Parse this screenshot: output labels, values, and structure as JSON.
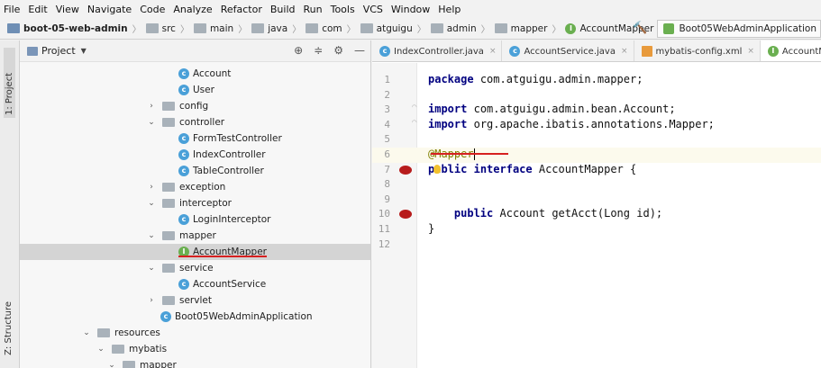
{
  "menu": [
    "File",
    "Edit",
    "View",
    "Navigate",
    "Code",
    "Analyze",
    "Refactor",
    "Build",
    "Run",
    "Tools",
    "VCS",
    "Window",
    "Help"
  ],
  "breadcrumb": [
    "boot-05-web-admin",
    "src",
    "main",
    "java",
    "com",
    "atguigu",
    "admin",
    "mapper",
    "AccountMapper"
  ],
  "run_config": "Boot05WebAdminApplication",
  "side_tabs": {
    "project": "1: Project",
    "structure": "Z: Structure"
  },
  "project_panel": {
    "title": "Project"
  },
  "tree": [
    {
      "label": "Account",
      "icon": "class-icon"
    },
    {
      "label": "User",
      "icon": "class-icon"
    },
    {
      "label": "config",
      "icon": "package-icon",
      "arrow": "›"
    },
    {
      "label": "controller",
      "icon": "package-icon",
      "arrow": "⌄"
    },
    {
      "label": "FormTestController",
      "icon": "class-icon"
    },
    {
      "label": "IndexController",
      "icon": "class-icon"
    },
    {
      "label": "TableController",
      "icon": "class-icon"
    },
    {
      "label": "exception",
      "icon": "package-icon",
      "arrow": "›"
    },
    {
      "label": "interceptor",
      "icon": "package-icon",
      "arrow": "⌄"
    },
    {
      "label": "LoginInterceptor",
      "icon": "class-icon"
    },
    {
      "label": "mapper",
      "icon": "package-icon",
      "arrow": "⌄"
    },
    {
      "label": "AccountMapper",
      "icon": "interface-icon",
      "selected": true
    },
    {
      "label": "service",
      "icon": "package-icon",
      "arrow": "⌄"
    },
    {
      "label": "AccountService",
      "icon": "class-icon"
    },
    {
      "label": "servlet",
      "icon": "package-icon",
      "arrow": "›"
    },
    {
      "label": "Boot05WebAdminApplication",
      "icon": "spring-class-icon"
    },
    {
      "label": "resources",
      "icon": "resources-folder-icon",
      "arrow": "⌄"
    },
    {
      "label": "mybatis",
      "icon": "folder-icon",
      "arrow": "⌄"
    },
    {
      "label": "mapper",
      "icon": "folder-icon",
      "arrow": "⌄"
    }
  ],
  "tabs": [
    {
      "label": "IndexController.java",
      "icon": "class-icon"
    },
    {
      "label": "AccountService.java",
      "icon": "class-icon"
    },
    {
      "label": "mybatis-config.xml",
      "icon": "xml-icon"
    },
    {
      "label": "AccountMap",
      "icon": "interface-icon",
      "active": true
    }
  ],
  "code_lines": [
    {
      "n": "1",
      "text": "package com.atguigu.admin.mapper;"
    },
    {
      "n": "2",
      "text": ""
    },
    {
      "n": "3",
      "text": "import com.atguigu.admin.bean.Account;"
    },
    {
      "n": "4",
      "text": "import org.apache.ibatis.annotations.Mapper;"
    },
    {
      "n": "5",
      "text": ""
    },
    {
      "n": "6",
      "text": "@Mapper"
    },
    {
      "n": "7",
      "text": "public interface AccountMapper {"
    },
    {
      "n": "8",
      "text": ""
    },
    {
      "n": "9",
      "text": ""
    },
    {
      "n": "10",
      "text": "    public Account getAcct(Long id);"
    },
    {
      "n": "11",
      "text": "}"
    },
    {
      "n": "12",
      "text": ""
    }
  ]
}
